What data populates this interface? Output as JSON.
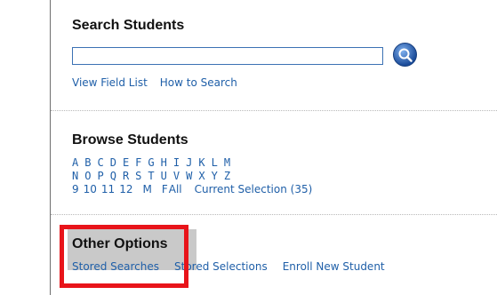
{
  "search": {
    "title": "Search Students",
    "input_value": "",
    "links": [
      "View Field List",
      "How to Search"
    ]
  },
  "browse": {
    "title": "Browse Students",
    "letters_row1": [
      "A",
      "B",
      "C",
      "D",
      "E",
      "F",
      "G",
      "H",
      "I",
      "J",
      "K",
      "L",
      "M"
    ],
    "letters_row2": [
      "N",
      "O",
      "P",
      "Q",
      "R",
      "S",
      "T",
      "U",
      "V",
      "W",
      "X",
      "Y",
      "Z"
    ],
    "filters": [
      "9",
      "10",
      "11",
      "12",
      "M",
      "F",
      "All"
    ],
    "current_selection": "Current Selection (35)"
  },
  "other": {
    "title": "Other Options",
    "links": [
      "Stored Searches",
      "Stored Selections",
      "Enroll New Student"
    ]
  },
  "colors": {
    "link": "#1f5fa8",
    "highlight_border": "#e8141a",
    "input_border": "#3c72b4"
  },
  "icons": {
    "search_button": "magnifier-icon"
  }
}
